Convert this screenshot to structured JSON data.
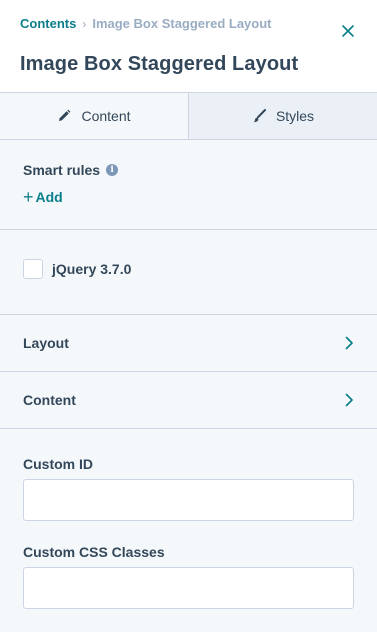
{
  "breadcrumb": {
    "parent": "Contents",
    "separator": "›",
    "current": "Image Box Staggered Layout"
  },
  "header": {
    "title": "Image Box Staggered Layout",
    "close_icon": "close-icon"
  },
  "tabs": [
    {
      "label": "Content",
      "icon": "pencil-icon",
      "active": true
    },
    {
      "label": "Styles",
      "icon": "brush-icon",
      "active": false
    }
  ],
  "smart_rules": {
    "label": "Smart rules",
    "info_glyph": "i",
    "add_label": "Add",
    "add_glyph": "+"
  },
  "options": {
    "jquery_label": "jQuery 3.7.0",
    "jquery_checked": false
  },
  "accordions": {
    "layout_label": "Layout",
    "content_label": "Content"
  },
  "fields": {
    "custom_id_label": "Custom ID",
    "custom_id_value": "",
    "custom_css_label": "Custom CSS Classes",
    "custom_css_value": ""
  },
  "colors": {
    "accent": "#0b7e8c",
    "text": "#33475b",
    "muted": "#99acc2",
    "border": "#cbd6e2",
    "panel": "#f5f8fa"
  }
}
